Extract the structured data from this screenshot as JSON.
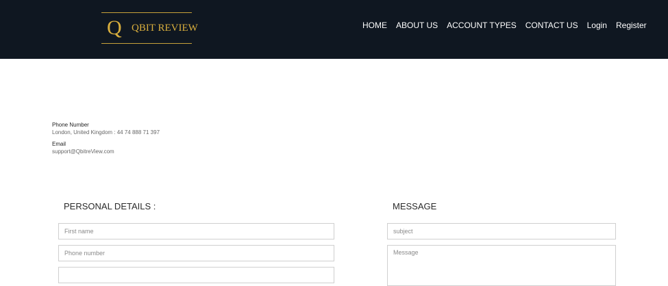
{
  "colors": {
    "header_bg": "#0f1721",
    "brand_gold": "#d8ae3d",
    "nav_text": "#ffffff",
    "field_border": "#cfcfcf"
  },
  "brand": {
    "mark": "Q",
    "name": "QBIT REVIEW"
  },
  "nav": {
    "items": [
      {
        "label": "HOME"
      },
      {
        "label": "ABOUT US"
      },
      {
        "label": "ACCOUNT TYPES"
      },
      {
        "label": "CONTACT US"
      },
      {
        "label": "Login"
      },
      {
        "label": "Register"
      }
    ]
  },
  "contact": {
    "phone_label": "Phone Number",
    "phone_value": "London, United Kingdom : 44 74 888 71 397",
    "email_label": "Email",
    "email_value": "support@QbitreView.com"
  },
  "personal": {
    "title": "PERSONAL DETAILS :",
    "first_name_placeholder": "First name",
    "phone_placeholder": "Phone number",
    "third_placeholder": ""
  },
  "message": {
    "title": "MESSAGE",
    "subject_placeholder": "subject",
    "message_placeholder": "Message"
  }
}
